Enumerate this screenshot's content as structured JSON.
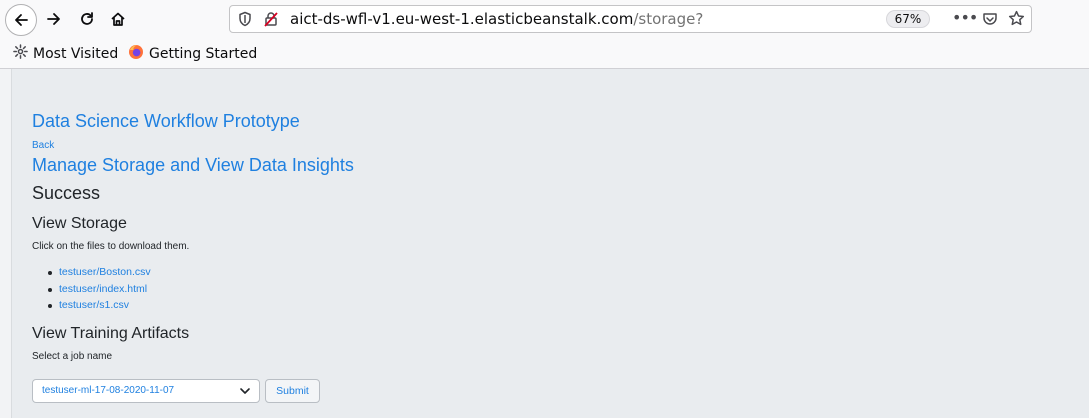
{
  "browser": {
    "url_host": "aict-ds-wfl-v1.eu-west-1.elasticbeanstalk.com",
    "url_path": "/storage?",
    "zoom": "67%",
    "more_glyph": "•••",
    "bookmarks": [
      {
        "label": "Most Visited",
        "icon": "gear-icon"
      },
      {
        "label": "Getting Started",
        "icon": "firefox-icon"
      }
    ]
  },
  "page": {
    "title": "Data Science Workflow Prototype",
    "back_link": "Back",
    "manage_heading": "Manage Storage and View Data Insights",
    "status": "Success",
    "storage_heading": "View Storage",
    "storage_hint": "Click on the files to download them.",
    "files": [
      "testuser/Boston.csv",
      "testuser/index.html",
      "testuser/s1.csv"
    ],
    "artifacts_heading": "View Training Artifacts",
    "select_label": "Select a job name",
    "job_selected": "testuser-ml-17-08-2020-11-07",
    "submit_label": "Submit"
  },
  "colors": {
    "link": "#1f80e0",
    "page_bg": "#e9ecef",
    "text": "#212529"
  }
}
